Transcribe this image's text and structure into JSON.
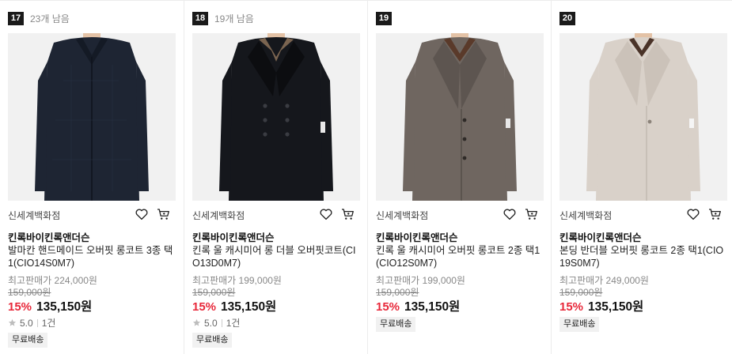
{
  "products": [
    {
      "rank": "17",
      "stock": "23개 남음",
      "store": "신세계백화점",
      "brand": "킨록바이킨록앤더슨",
      "name": "발마칸 핸드메이드 오버핏 롱코트 3종 택1(CIO14S0M7)",
      "max_price": "최고판매가 224,000원",
      "orig_price": "159,000원",
      "discount": "15%",
      "price": "135,150원",
      "rating": "5.0",
      "reviews": "1건",
      "shipping": "무료배송",
      "coat_color": "#1e2533"
    },
    {
      "rank": "18",
      "stock": "19개 남음",
      "store": "신세계백화점",
      "brand": "킨록바이킨록앤더슨",
      "name": "킨록 울 캐시미어 롱 더블 오버핏코트(CIO13D0M7)",
      "max_price": "최고판매가 199,000원",
      "orig_price": "159,000원",
      "discount": "15%",
      "price": "135,150원",
      "rating": "5.0",
      "reviews": "1건",
      "shipping": "무료배송",
      "coat_color": "#15171c"
    },
    {
      "rank": "19",
      "stock": "",
      "store": "신세계백화점",
      "brand": "킨록바이킨록앤더슨",
      "name": "킨록 울 캐시미어 오버핏 롱코트 2종 택1(CIO12S0M7)",
      "max_price": "최고판매가 199,000원",
      "orig_price": "159,000원",
      "discount": "15%",
      "price": "135,150원",
      "rating": "",
      "reviews": "",
      "shipping": "무료배송",
      "coat_color": "#6f6660"
    },
    {
      "rank": "20",
      "stock": "",
      "store": "신세계백화점",
      "brand": "킨록바이킨록앤더슨",
      "name": "본딩 반더블 오버핏 롱코트 2종 택1(CIO19S0M7)",
      "max_price": "최고판매가 249,000원",
      "orig_price": "159,000원",
      "discount": "15%",
      "price": "135,150원",
      "rating": "",
      "reviews": "",
      "shipping": "무료배송",
      "coat_color": "#d9d1c9"
    }
  ],
  "colors": {
    "discount": "#e8283a",
    "star": "#bdbdbd",
    "rank_badge": "#1a1a1a"
  },
  "icons": {
    "wishlist": "heart-icon",
    "cart": "cart-icon",
    "rating": "star-icon"
  }
}
